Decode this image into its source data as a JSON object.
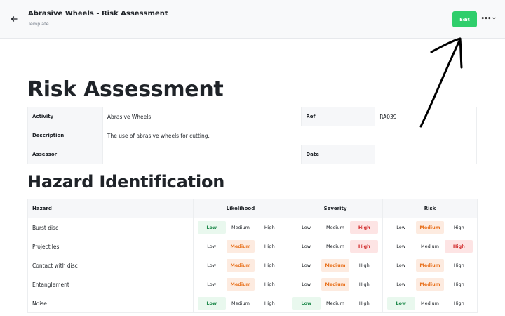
{
  "header": {
    "title": "Abrasive Wheels - Risk Assessment",
    "subtitle": "Template",
    "edit_label": "Edit",
    "more_label": "•••",
    "colors": {
      "edit_bg": "#2fce6b",
      "topbar_bg": "#f8f9fa"
    }
  },
  "page_title": "Risk Assessment",
  "info": {
    "activity_label": "Activity",
    "activity_value": "Abrasive Wheels",
    "ref_label": "Ref",
    "ref_value": "RA039",
    "description_label": "Description",
    "description_value": "The use of abrasive wheels for cutting.",
    "assessor_label": "Assessor",
    "assessor_value": "",
    "date_label": "Date",
    "date_value": ""
  },
  "hazard_section_title": "Hazard Identification",
  "hazard_table": {
    "headers": {
      "hazard": "Hazard",
      "likelihood": "Likelihood",
      "severity": "Severity",
      "risk": "Risk"
    },
    "levels": [
      "Low",
      "Medium",
      "High"
    ],
    "rows": [
      {
        "hazard": "Burst disc",
        "likelihood": "Low",
        "severity": "High",
        "risk": "Medium"
      },
      {
        "hazard": "Projectiles",
        "likelihood": "Medium",
        "severity": "High",
        "risk": "High"
      },
      {
        "hazard": "Contact with disc",
        "likelihood": "Medium",
        "severity": "Medium",
        "risk": "Medium"
      },
      {
        "hazard": "Entanglement",
        "likelihood": "Medium",
        "severity": "Medium",
        "risk": "Medium"
      },
      {
        "hazard": "Noise",
        "likelihood": "Low",
        "severity": "Low",
        "risk": "Low"
      }
    ],
    "colors": {
      "low": "#1f8a4c",
      "medium": "#e8711d",
      "high": "#d12d2d"
    }
  }
}
